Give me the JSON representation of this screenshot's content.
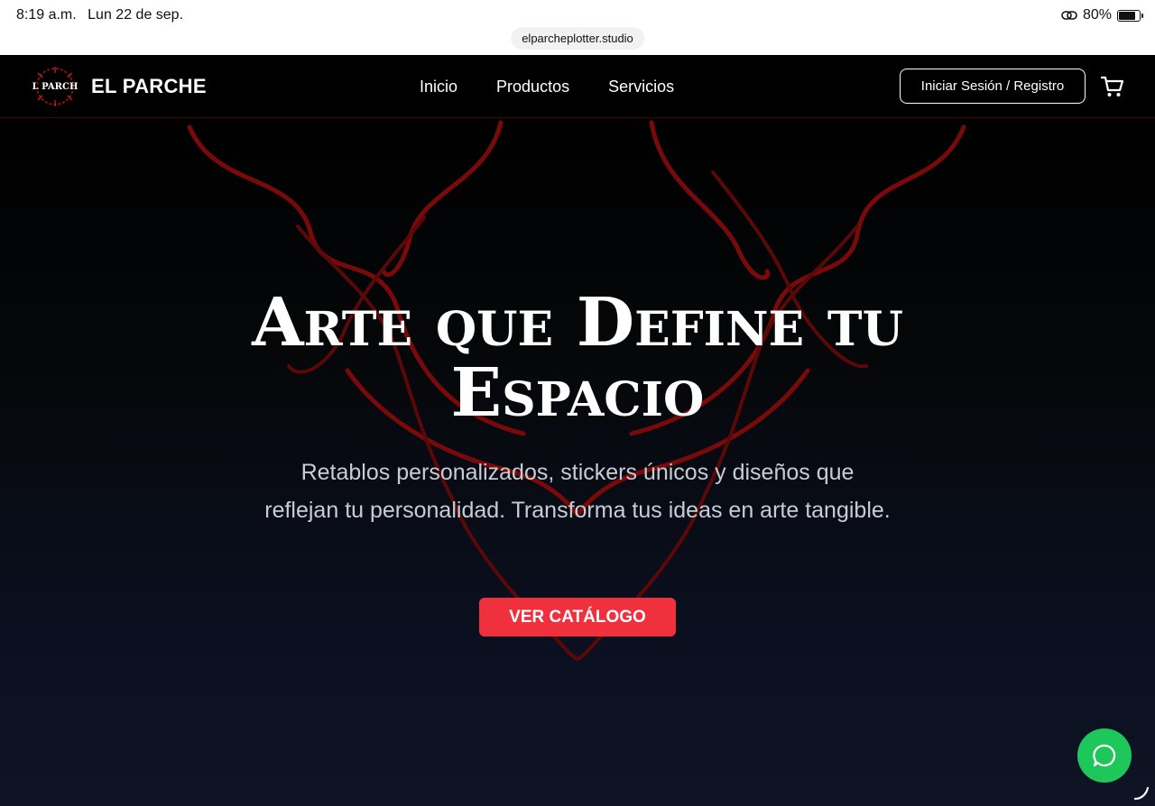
{
  "status_bar": {
    "time": "8:19 a.m.",
    "date": "Lun 22 de sep.",
    "battery": "80%",
    "battery_level": 0.8
  },
  "browser": {
    "url": "elparcheplotter.studio"
  },
  "nav": {
    "logo_text": "EL PARCHE",
    "brand": "EL PARCHE",
    "links": [
      "Inicio",
      "Productos",
      "Servicios"
    ],
    "login_label": "Iniciar Sesión / Registro"
  },
  "hero": {
    "title_line1": "Arte que Define tu",
    "title_line2": "Espacio",
    "subtitle": "Retablos personalizados, stickers únicos y diseños que reflejan tu personalidad. Transforma tus ideas en arte tangible.",
    "cta_label": "VER CATÁLOGO"
  },
  "colors": {
    "accent": "#f0303c",
    "deco": "#7a0a0a",
    "whatsapp": "#1ec75a",
    "nav_bg": "#000000"
  },
  "icons": [
    "link-icon",
    "battery-icon",
    "cart-icon",
    "whatsapp-icon"
  ]
}
